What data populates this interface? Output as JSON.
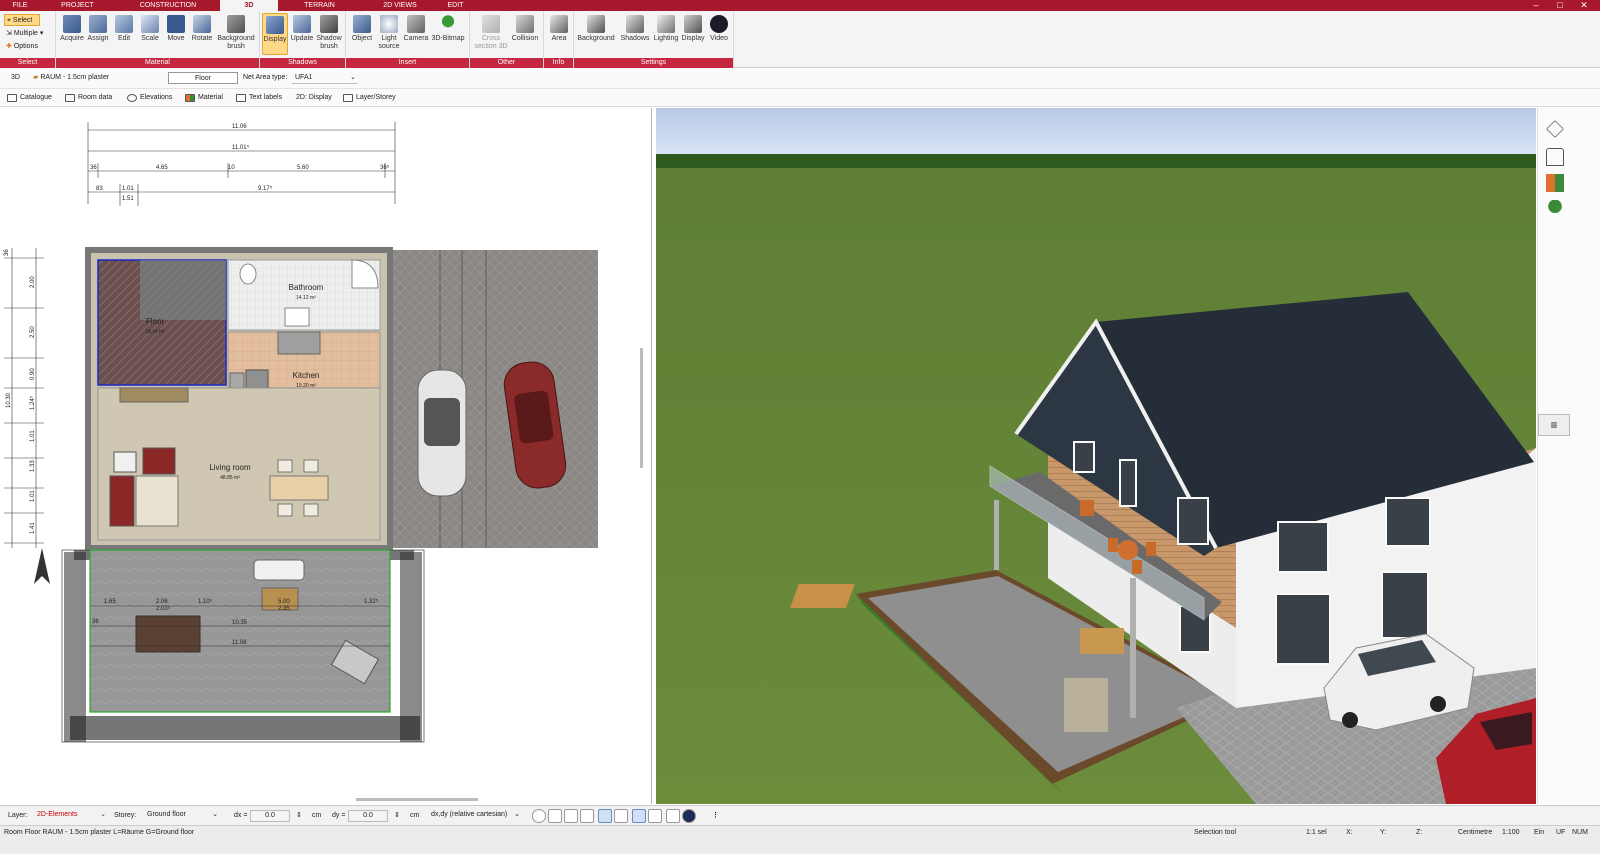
{
  "tabs": [
    "FILE",
    "PROJECT",
    "CONSTRUCTION",
    "3D",
    "TERRAIN",
    "2D VIEWS",
    "EDIT"
  ],
  "window_controls": {
    "minimize": "–",
    "maximize": "□",
    "close": "✕"
  },
  "ribbon": {
    "select": {
      "label": "Select",
      "items": [
        "Select",
        "Multiple",
        "Options"
      ]
    },
    "material": {
      "label": "Material",
      "buttons": [
        "Acquire",
        "Assign",
        "Edit",
        "Scale",
        "Move",
        "Rotate",
        "Background brush"
      ]
    },
    "shadows": {
      "label": "Shadows",
      "buttons": [
        "Display",
        "Update",
        "Shadow brush"
      ]
    },
    "insert": {
      "label": "Insert",
      "buttons": [
        "Object",
        "Light source",
        "Camera",
        "3D-Bitmap"
      ]
    },
    "other": {
      "label": "Other",
      "buttons": [
        "Cross section 3D",
        "Collision"
      ]
    },
    "info": {
      "label": "Info",
      "buttons": [
        "Area"
      ]
    },
    "settings": {
      "label": "Settings",
      "buttons": [
        "Background",
        "Shadows",
        "Lighting",
        "Display",
        "Video"
      ]
    }
  },
  "toolbar1": {
    "mode": "3D",
    "room": "RAUM - 1.5cm plaster",
    "floor_value": "Floor",
    "net_area_label": "Net Area type:",
    "net_area_value": "UFA1"
  },
  "toolbar2": [
    "Catalogue",
    "Room data",
    "Elevations",
    "Material",
    "Text labels",
    "2D: Display",
    "Layer/Storey"
  ],
  "plan": {
    "rooms": [
      {
        "name": "Floor",
        "area": "18.14 m²"
      },
      {
        "name": "Bathroom",
        "area": "14.12 m²"
      },
      {
        "name": "Kitchen",
        "area": "19.20 m²"
      },
      {
        "name": "Living room",
        "area": "48.85 m²"
      }
    ],
    "dims": [
      "11.06",
      "11.01⁵",
      "4.65",
      "10",
      "5.60",
      "36⁵",
      "36",
      "83",
      "1.01",
      "9.17⁵",
      "1.51",
      "36",
      "2.00",
      "2.50",
      "0.90",
      "1.24⁵",
      "1.01",
      "1.33",
      "1.01",
      "1.41",
      "10.30",
      "1.65",
      "2.06",
      "1.10⁵",
      "5.00",
      "1.32⁵",
      "2.03⁵",
      "2.35",
      "10.35",
      "11.06",
      "36",
      "1.01",
      "1.01"
    ]
  },
  "colors": {
    "accent": "#a8182c",
    "group_label": "#c4273f",
    "grass": "#6a8a3a",
    "sky": "#c8d8f0",
    "roof": "#252e38",
    "wood": "#c89868",
    "wall": "#f2f2f2"
  },
  "bottom": {
    "layer_label": "Layer:",
    "layer_value": "2D-Elements",
    "storey_label": "Storey:",
    "storey_value": "Ground floor",
    "dx_label": "dx =",
    "dx_value": "0.0",
    "dx_unit": "cm",
    "dy_label": "dy =",
    "dy_value": "0.0",
    "dy_unit": "cm",
    "coord_mode": "dx,dy (relative cartesian)"
  },
  "status": {
    "left": "Room Floor RAUM - 1.5cm plaster L=Räume G=Ground floor",
    "tool": "Selection tool",
    "scale1": "1:1 sel",
    "x": "X:",
    "y": "Y:",
    "z": "Z:",
    "unit": "Centimetre",
    "scale2": "1:100",
    "ein": "Ein",
    "uf": "UF",
    "num": "NUM"
  }
}
